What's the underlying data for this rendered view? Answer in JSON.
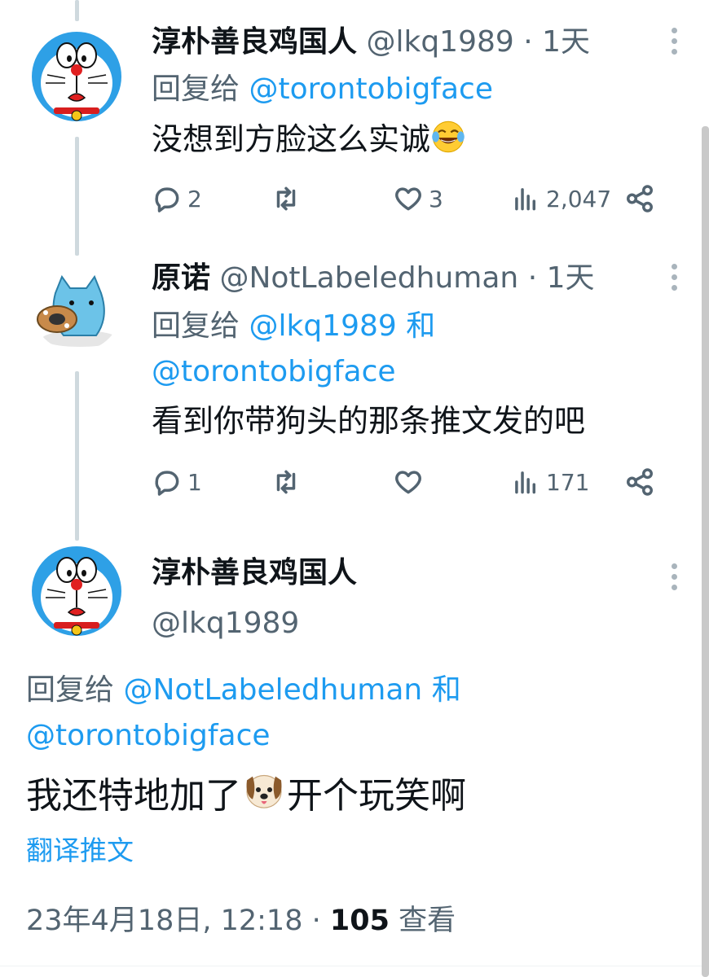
{
  "tweets": [
    {
      "display_name": "淳朴善良鸡国人",
      "handle": "@lkq1989",
      "sep": "·",
      "time": "1天",
      "reply_prefix": "回复给",
      "reply_to": "@torontobigface",
      "body": "没想到方脸这么实诚",
      "emoji": "face-with-tears-of-joy",
      "replies": "2",
      "retweets": "",
      "likes": "3",
      "views": "2,047"
    },
    {
      "display_name": "原诺",
      "handle": "@NotLabeledhuman",
      "sep": "·",
      "time": "1天",
      "reply_prefix": "回复给",
      "reply_to_1": "@lkq1989",
      "reply_and": "和",
      "reply_to_2": "@torontobigface",
      "body": "看到你带狗头的那条推文发的吧",
      "replies": "1",
      "retweets": "",
      "likes": "",
      "views": "171"
    }
  ],
  "focus": {
    "display_name": "淳朴善良鸡国人",
    "handle": "@lkq1989",
    "reply_prefix": "回复给",
    "reply_to_1": "@NotLabeledhuman",
    "reply_and": "和",
    "reply_to_2": "@torontobigface",
    "body_before": "我还特地加了",
    "emoji": "dog-face",
    "body_after": "开个玩笑啊",
    "translate_label": "翻译推文",
    "timestamp": "23年4月18日, 12:18",
    "sep": "·",
    "views_count": "105",
    "views_label": "查看"
  },
  "colors": {
    "link": "#1d9bf0",
    "muted": "#536471",
    "text": "#0f1419"
  }
}
